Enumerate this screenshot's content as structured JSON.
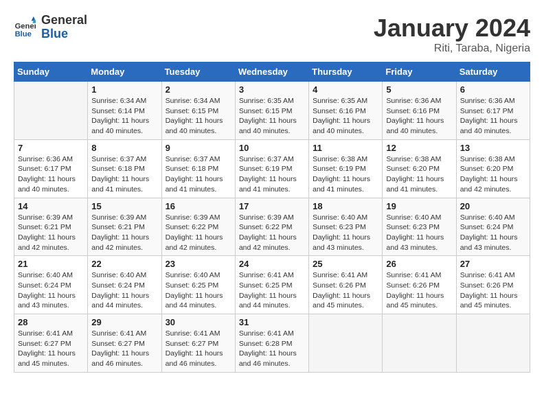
{
  "header": {
    "logo_general": "General",
    "logo_blue": "Blue",
    "title": "January 2024",
    "subtitle": "Riti, Taraba, Nigeria"
  },
  "days_of_week": [
    "Sunday",
    "Monday",
    "Tuesday",
    "Wednesday",
    "Thursday",
    "Friday",
    "Saturday"
  ],
  "weeks": [
    [
      {
        "day": "",
        "info": ""
      },
      {
        "day": "1",
        "info": "Sunrise: 6:34 AM\nSunset: 6:14 PM\nDaylight: 11 hours and 40 minutes."
      },
      {
        "day": "2",
        "info": "Sunrise: 6:34 AM\nSunset: 6:15 PM\nDaylight: 11 hours and 40 minutes."
      },
      {
        "day": "3",
        "info": "Sunrise: 6:35 AM\nSunset: 6:15 PM\nDaylight: 11 hours and 40 minutes."
      },
      {
        "day": "4",
        "info": "Sunrise: 6:35 AM\nSunset: 6:16 PM\nDaylight: 11 hours and 40 minutes."
      },
      {
        "day": "5",
        "info": "Sunrise: 6:36 AM\nSunset: 6:16 PM\nDaylight: 11 hours and 40 minutes."
      },
      {
        "day": "6",
        "info": "Sunrise: 6:36 AM\nSunset: 6:17 PM\nDaylight: 11 hours and 40 minutes."
      }
    ],
    [
      {
        "day": "7",
        "info": "Sunrise: 6:36 AM\nSunset: 6:17 PM\nDaylight: 11 hours and 40 minutes."
      },
      {
        "day": "8",
        "info": "Sunrise: 6:37 AM\nSunset: 6:18 PM\nDaylight: 11 hours and 41 minutes."
      },
      {
        "day": "9",
        "info": "Sunrise: 6:37 AM\nSunset: 6:18 PM\nDaylight: 11 hours and 41 minutes."
      },
      {
        "day": "10",
        "info": "Sunrise: 6:37 AM\nSunset: 6:19 PM\nDaylight: 11 hours and 41 minutes."
      },
      {
        "day": "11",
        "info": "Sunrise: 6:38 AM\nSunset: 6:19 PM\nDaylight: 11 hours and 41 minutes."
      },
      {
        "day": "12",
        "info": "Sunrise: 6:38 AM\nSunset: 6:20 PM\nDaylight: 11 hours and 41 minutes."
      },
      {
        "day": "13",
        "info": "Sunrise: 6:38 AM\nSunset: 6:20 PM\nDaylight: 11 hours and 42 minutes."
      }
    ],
    [
      {
        "day": "14",
        "info": "Sunrise: 6:39 AM\nSunset: 6:21 PM\nDaylight: 11 hours and 42 minutes."
      },
      {
        "day": "15",
        "info": "Sunrise: 6:39 AM\nSunset: 6:21 PM\nDaylight: 11 hours and 42 minutes."
      },
      {
        "day": "16",
        "info": "Sunrise: 6:39 AM\nSunset: 6:22 PM\nDaylight: 11 hours and 42 minutes."
      },
      {
        "day": "17",
        "info": "Sunrise: 6:39 AM\nSunset: 6:22 PM\nDaylight: 11 hours and 42 minutes."
      },
      {
        "day": "18",
        "info": "Sunrise: 6:40 AM\nSunset: 6:23 PM\nDaylight: 11 hours and 43 minutes."
      },
      {
        "day": "19",
        "info": "Sunrise: 6:40 AM\nSunset: 6:23 PM\nDaylight: 11 hours and 43 minutes."
      },
      {
        "day": "20",
        "info": "Sunrise: 6:40 AM\nSunset: 6:24 PM\nDaylight: 11 hours and 43 minutes."
      }
    ],
    [
      {
        "day": "21",
        "info": "Sunrise: 6:40 AM\nSunset: 6:24 PM\nDaylight: 11 hours and 43 minutes."
      },
      {
        "day": "22",
        "info": "Sunrise: 6:40 AM\nSunset: 6:24 PM\nDaylight: 11 hours and 44 minutes."
      },
      {
        "day": "23",
        "info": "Sunrise: 6:40 AM\nSunset: 6:25 PM\nDaylight: 11 hours and 44 minutes."
      },
      {
        "day": "24",
        "info": "Sunrise: 6:41 AM\nSunset: 6:25 PM\nDaylight: 11 hours and 44 minutes."
      },
      {
        "day": "25",
        "info": "Sunrise: 6:41 AM\nSunset: 6:26 PM\nDaylight: 11 hours and 45 minutes."
      },
      {
        "day": "26",
        "info": "Sunrise: 6:41 AM\nSunset: 6:26 PM\nDaylight: 11 hours and 45 minutes."
      },
      {
        "day": "27",
        "info": "Sunrise: 6:41 AM\nSunset: 6:26 PM\nDaylight: 11 hours and 45 minutes."
      }
    ],
    [
      {
        "day": "28",
        "info": "Sunrise: 6:41 AM\nSunset: 6:27 PM\nDaylight: 11 hours and 45 minutes."
      },
      {
        "day": "29",
        "info": "Sunrise: 6:41 AM\nSunset: 6:27 PM\nDaylight: 11 hours and 46 minutes."
      },
      {
        "day": "30",
        "info": "Sunrise: 6:41 AM\nSunset: 6:27 PM\nDaylight: 11 hours and 46 minutes."
      },
      {
        "day": "31",
        "info": "Sunrise: 6:41 AM\nSunset: 6:28 PM\nDaylight: 11 hours and 46 minutes."
      },
      {
        "day": "",
        "info": ""
      },
      {
        "day": "",
        "info": ""
      },
      {
        "day": "",
        "info": ""
      }
    ]
  ]
}
